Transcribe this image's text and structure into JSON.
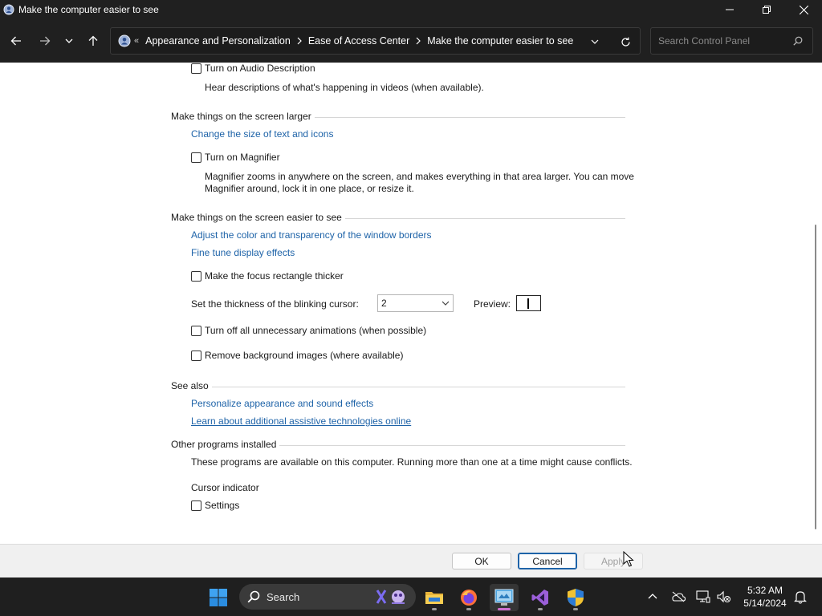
{
  "window": {
    "title": "Make the computer easier to see"
  },
  "address": {
    "crumbs": [
      "Appearance and Personalization",
      "Ease of Access Center",
      "Make the computer easier to see"
    ],
    "search_placeholder": "Search Control Panel"
  },
  "content": {
    "audio_description_label": "Turn on Audio Description",
    "audio_description_desc": "Hear descriptions of what's happening in videos (when available).",
    "larger_heading": "Make things on the screen larger",
    "change_size_link": "Change the size of text and icons",
    "magnifier_label": "Turn on Magnifier",
    "magnifier_desc_1": "Magnifier zooms in anywhere on the screen, and makes everything in that area larger. You can move",
    "magnifier_desc_2": "Magnifier around, lock it in one place, or resize it.",
    "easier_heading": "Make things on the screen easier to see",
    "adjust_color_link": "Adjust the color and transparency of the window borders",
    "fine_tune_link": "Fine tune display effects",
    "focus_rect_label": "Make the focus rectangle thicker",
    "cursor_thickness_label": "Set the thickness of the blinking cursor:",
    "cursor_thickness_value": "2",
    "preview_label": "Preview:",
    "animations_label": "Turn off all unnecessary animations (when possible)",
    "bg_images_label": "Remove background images (where available)",
    "see_also_heading": "See also",
    "personalize_link": "Personalize appearance and sound effects",
    "assistive_link": "Learn about additional assistive technologies online",
    "other_heading": "Other programs installed",
    "other_desc": "These programs are available on this computer. Running more than one at a time might cause conflicts.",
    "cursor_indicator_label": "Cursor indicator",
    "settings_label": "Settings"
  },
  "checkboxes": {
    "audio_description": false,
    "magnifier": false,
    "focus_rect": false,
    "animations": false,
    "bg_images": false,
    "cursor_indicator_settings": false
  },
  "buttons": {
    "ok": "OK",
    "cancel": "Cancel",
    "apply": "Apply"
  },
  "taskbar": {
    "search_label": "Search",
    "time": "5:32 AM",
    "date": "5/14/2024"
  },
  "colors": {
    "link": "#1e63a8",
    "chrome": "#202020",
    "taskbar": "#1f1f1f"
  },
  "icons": [
    "control-panel-icon",
    "minimize-icon",
    "maximize-icon",
    "close-icon",
    "back-arrow-icon",
    "forward-arrow-icon",
    "recent-chevron-icon",
    "up-arrow-icon",
    "address-dropdown-icon",
    "refresh-icon",
    "search-icon",
    "windows-start-icon",
    "file-explorer-icon",
    "firefox-icon",
    "control-panel-taskbar-icon",
    "visual-studio-icon",
    "security-shield-icon",
    "tray-chevron-icon",
    "onedrive-icon",
    "network-icon",
    "volume-muted-icon",
    "notification-bell-icon"
  ]
}
